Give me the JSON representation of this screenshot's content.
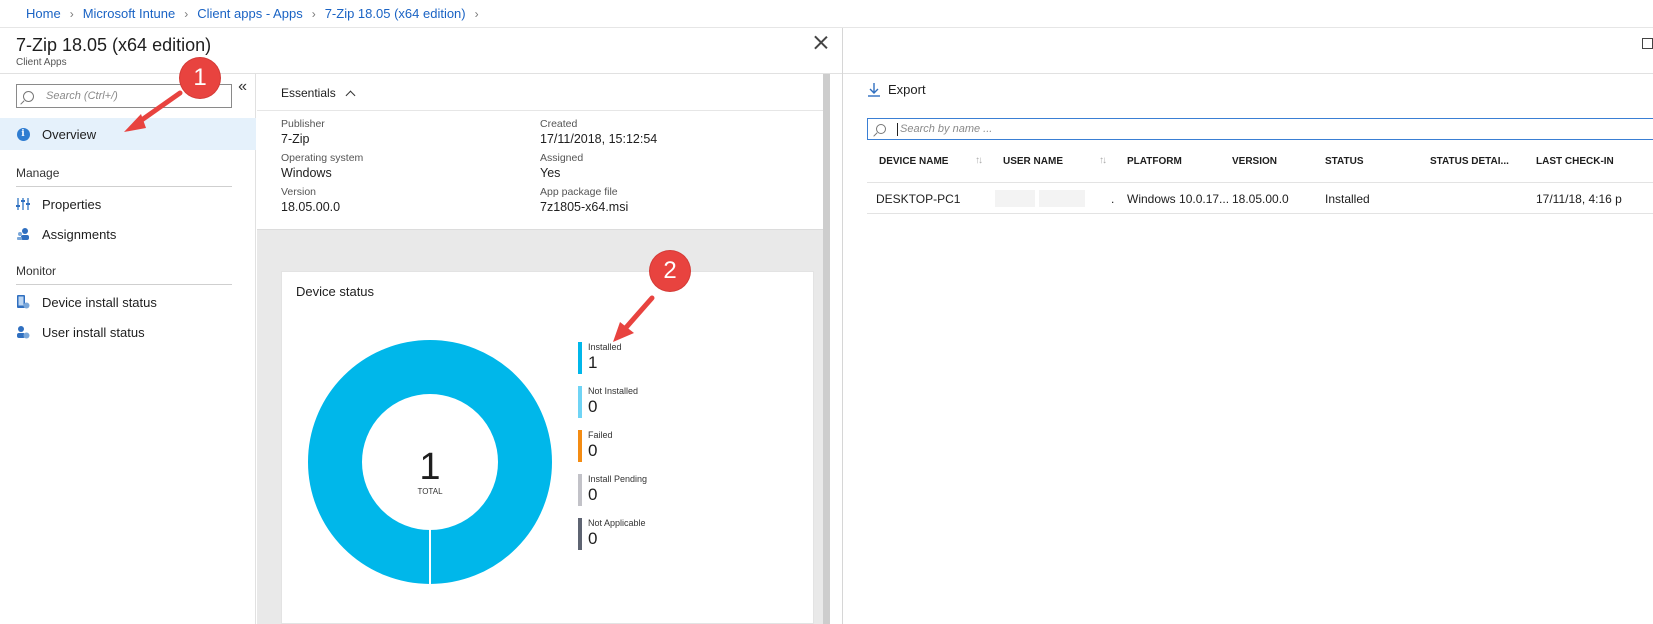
{
  "breadcrumb": {
    "items": [
      "Home",
      "Microsoft Intune",
      "Client apps - Apps",
      "7-Zip 18.05 (x64 edition)"
    ]
  },
  "blade": {
    "title": "7-Zip 18.05 (x64 edition)",
    "subtitle": "Client Apps"
  },
  "nav": {
    "search_placeholder": "Search (Ctrl+/)",
    "overview": "Overview",
    "manage_header": "Manage",
    "properties": "Properties",
    "assignments": "Assignments",
    "monitor_header": "Monitor",
    "device_install_status": "Device install status",
    "user_install_status": "User install status"
  },
  "essentials": {
    "header": "Essentials",
    "publisher_label": "Publisher",
    "publisher_value": "7-Zip",
    "os_label": "Operating system",
    "os_value": "Windows",
    "version_label": "Version",
    "version_value": "18.05.00.0",
    "created_label": "Created",
    "created_value": "17/11/2018, 15:12:54",
    "assigned_label": "Assigned",
    "assigned_value": "Yes",
    "package_label": "App package file",
    "package_value": "7z1805-x64.msi"
  },
  "device_status": {
    "title": "Device status",
    "total_value": "1",
    "total_label": "TOTAL",
    "legend": [
      {
        "label": "Installed",
        "value": "1",
        "color": "#00b7ea"
      },
      {
        "label": "Not Installed",
        "value": "0",
        "color": "#6fd4f5"
      },
      {
        "label": "Failed",
        "value": "0",
        "color": "#f48c13"
      },
      {
        "label": "Install Pending",
        "value": "0",
        "color": "#c2c2c8"
      },
      {
        "label": "Not Applicable",
        "value": "0",
        "color": "#5e6472"
      }
    ]
  },
  "right": {
    "export_label": "Export",
    "search_placeholder": "Search by name ...",
    "columns": [
      "DEVICE NAME",
      "USER NAME",
      "PLATFORM",
      "VERSION",
      "STATUS",
      "STATUS DETAI...",
      "LAST CHECK-IN"
    ],
    "rows": [
      {
        "device": "DESKTOP-PC1",
        "user": ".",
        "platform": "Windows 10.0.17...",
        "version": "18.05.00.0",
        "status": "Installed",
        "status_details": "",
        "last_checkin": "17/11/18, 4:16 p"
      }
    ]
  },
  "annotations": {
    "badge1": "1",
    "badge2": "2",
    "color": "#e8433f"
  }
}
